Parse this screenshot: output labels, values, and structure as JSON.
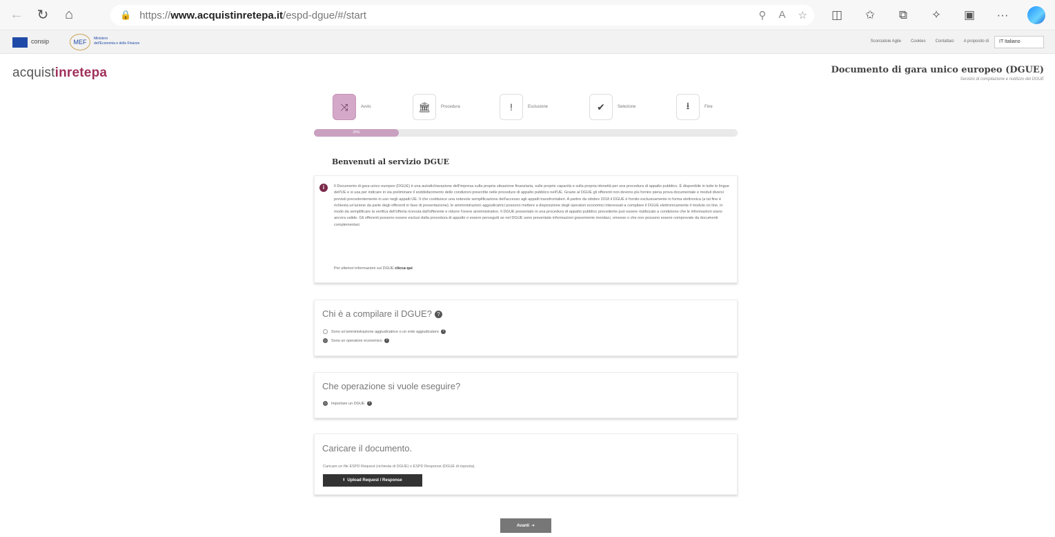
{
  "browser": {
    "url_prefix": "https://",
    "url_host": "www.acquistinretepa.it",
    "url_path": "/espd-dgue/#/start"
  },
  "topbar": {
    "consip": "consip",
    "mef_logo": "MEF",
    "mef_line1": "Ministero",
    "mef_line2": "dell'Economia e delle Finanze",
    "links": [
      "Scorciatoie Agile",
      "Cookies",
      "Contattaci",
      "A proposito di"
    ],
    "language": "IT Italiano"
  },
  "header": {
    "brand_a": "acquist",
    "brand_b": "inrete",
    "brand_c": "pa",
    "title": "Documento di gara unico europeo (DGUE)",
    "subtitle": "Servizio di compilazione e riutilizzo del DGUE"
  },
  "wizard": {
    "steps": [
      {
        "label": "Avvio",
        "icon": "shuffle-icon"
      },
      {
        "label": "Procedura",
        "icon": "bank-icon"
      },
      {
        "label": "Esclusione",
        "icon": "exclamation-icon"
      },
      {
        "label": "Selezione",
        "icon": "check-circle-icon"
      },
      {
        "label": "Fine",
        "icon": "download-icon"
      }
    ],
    "progress_percent": 20,
    "progress_label": "20%"
  },
  "welcome": "Benvenuti al servizio DGUE",
  "info": {
    "text": "Il Documento di gara unico europeo (DGUE) è una autodichiarazione dell'impresa sulla propria situazione finanziaria, sulle proprie capacità e sulla propria idoneità per una procedura di appalto pubblico. È disponibile in tutte le lingue dell'UE e si usa per indicare in via preliminare il soddisfacimento delle condizioni prescritte nelle procedure di appalto pubblico nell'UE. Grazie al DGUE gli offerenti non devono più fornire piena prova documentale e moduli diversi previsti precedentemente in uso negli appalti UE. Il che costituisce una notevole semplificazione dell'accesso agli appalti transfrontalieri. A partire da ottobre 2018 il DGUE è fornito esclusivamente in forma elettronica (a tal fine è richiesta un'azione da parte degli offerenti in fase di presentazione); le amministrazioni aggiudicatrici possono mettere a disposizione degli operatori economici interessati a compilare il DGUE elettronicamente il modulo on line, in modo da semplificare la verifica dell'offerta ricevuta dall'offerente e ridurre l'onere amministrativo. Il DGUE presentato in una procedura di appalto pubblico precedente può essere riutilizzato a condizione che le informazioni siano ancora valide. Gli offerenti possono essere esclusi dalla procedura di appalto o essere perseguiti se nel DGUE sono presentate informazioni gravemente mendaci, omesse o che non possono essere comprovate da documenti complementari.",
    "more_prefix": "Per ulteriori informazioni sul DGUE",
    "more_link": "clicca qui"
  },
  "who": {
    "title": "Chi è a compilare il DGUE?",
    "options": [
      {
        "label": "Sono un'amministrazione aggiudicatrice o un ente aggiudicatore",
        "selected": false
      },
      {
        "label": "Sono un operatore economico",
        "selected": true
      }
    ]
  },
  "operation": {
    "title": "Che operazione si vuole eseguire?",
    "options": [
      {
        "label": "Importare un DGUE",
        "selected": true
      }
    ]
  },
  "upload": {
    "title": "Caricare il documento.",
    "note": "Caricare un file ESPD Request (richiesta di DGUE) o ESPD Response (DGUE di risposta).",
    "button": "Upload Request / Response"
  },
  "next_button": "Avanti"
}
